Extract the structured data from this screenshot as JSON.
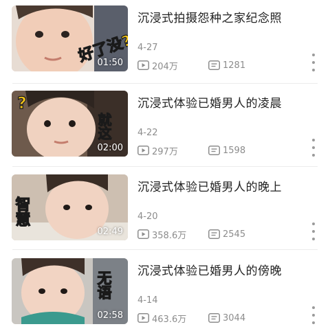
{
  "colors": {
    "title": "#222222",
    "meta": "#8c8c8c",
    "sticker_fill": "#f5c518",
    "sticker_stroke": "#1a1a1a",
    "divider": "#ececec"
  },
  "videos": [
    {
      "title": "沉浸式拍摄怨种之家纪念照",
      "duration": "01:50",
      "date": "4-27",
      "views": "204万",
      "comments": "1281",
      "sticker_text": "好了没?",
      "sticker_text_2": ""
    },
    {
      "title": "沉浸式体验已婚男人的凌晨",
      "duration": "02:00",
      "date": "4-22",
      "views": "297万",
      "comments": "1598",
      "sticker_text": "?",
      "sticker_text_2": "就这"
    },
    {
      "title": "沉浸式体验已婚男人的晚上",
      "duration": "02:49",
      "date": "4-20",
      "views": "358.6万",
      "comments": "2545",
      "sticker_text": "智慧",
      "sticker_text_2": ""
    },
    {
      "title": "沉浸式体验已婚男人的傍晚",
      "duration": "02:58",
      "date": "4-14",
      "views": "463.6万",
      "comments": "3044",
      "sticker_text": "无语",
      "sticker_text_2": ""
    }
  ],
  "icons": {
    "views": "play-icon",
    "comments": "comment-icon",
    "more": "more-vertical-icon"
  }
}
